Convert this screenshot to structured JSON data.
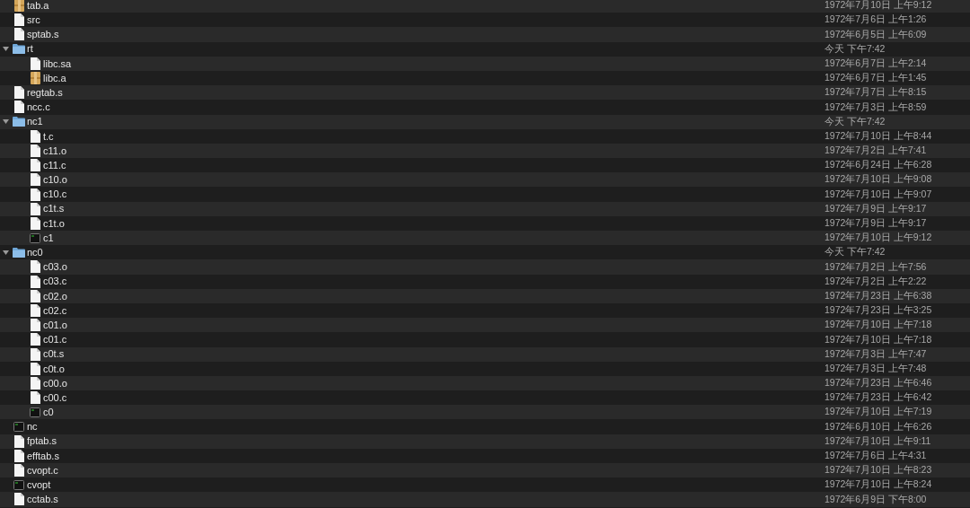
{
  "files": [
    {
      "name": "tab.a",
      "kind": "archive",
      "date": "1972年7月10日 上午9:12"
    },
    {
      "name": "src",
      "kind": "document",
      "date": "1972年7月6日 上午1:26"
    },
    {
      "name": "sptab.s",
      "kind": "document",
      "date": "1972年6月5日 上午6:09"
    },
    {
      "name": "rt",
      "kind": "folder",
      "expanded": true,
      "date": "今天 下午7:42",
      "children": [
        {
          "name": "libc.sa",
          "kind": "document",
          "date": "1972年6月7日 上午2:14"
        },
        {
          "name": "libc.a",
          "kind": "archive",
          "date": "1972年6月7日 上午1:45"
        }
      ]
    },
    {
      "name": "regtab.s",
      "kind": "document",
      "date": "1972年7月7日 上午8:15"
    },
    {
      "name": "ncc.c",
      "kind": "document",
      "date": "1972年7月3日 上午8:59"
    },
    {
      "name": "nc1",
      "kind": "folder",
      "expanded": true,
      "date": "今天 下午7:42",
      "children": [
        {
          "name": "t.c",
          "kind": "document",
          "date": "1972年7月10日 上午8:44"
        },
        {
          "name": "c11.o",
          "kind": "document",
          "date": "1972年7月2日 上午7:41"
        },
        {
          "name": "c11.c",
          "kind": "document",
          "date": "1972年6月24日 上午6:28"
        },
        {
          "name": "c10.o",
          "kind": "document",
          "date": "1972年7月10日 上午9:08"
        },
        {
          "name": "c10.c",
          "kind": "document",
          "date": "1972年7月10日 上午9:07"
        },
        {
          "name": "c1t.s",
          "kind": "document",
          "date": "1972年7月9日 上午9:17"
        },
        {
          "name": "c1t.o",
          "kind": "document",
          "date": "1972年7月9日 上午9:17"
        },
        {
          "name": "c1",
          "kind": "executable",
          "date": "1972年7月10日 上午9:12"
        }
      ]
    },
    {
      "name": "nc0",
      "kind": "folder",
      "expanded": true,
      "date": "今天 下午7:42",
      "children": [
        {
          "name": "c03.o",
          "kind": "document",
          "date": "1972年7月2日 上午7:56"
        },
        {
          "name": "c03.c",
          "kind": "document",
          "date": "1972年7月2日 上午2:22"
        },
        {
          "name": "c02.o",
          "kind": "document",
          "date": "1972年7月23日 上午6:38"
        },
        {
          "name": "c02.c",
          "kind": "document",
          "date": "1972年7月23日 上午3:25"
        },
        {
          "name": "c01.o",
          "kind": "document",
          "date": "1972年7月10日 上午7:18"
        },
        {
          "name": "c01.c",
          "kind": "document",
          "date": "1972年7月10日 上午7:18"
        },
        {
          "name": "c0t.s",
          "kind": "document",
          "date": "1972年7月3日 上午7:47"
        },
        {
          "name": "c0t.o",
          "kind": "document",
          "date": "1972年7月3日 上午7:48"
        },
        {
          "name": "c00.o",
          "kind": "document",
          "date": "1972年7月23日 上午6:46"
        },
        {
          "name": "c00.c",
          "kind": "document",
          "date": "1972年7月23日 上午6:42"
        },
        {
          "name": "c0",
          "kind": "executable",
          "date": "1972年7月10日 上午7:19"
        }
      ]
    },
    {
      "name": "nc",
      "kind": "executable",
      "date": "1972年6月10日 上午6:26"
    },
    {
      "name": "fptab.s",
      "kind": "document",
      "date": "1972年7月10日 上午9:11"
    },
    {
      "name": "efftab.s",
      "kind": "document",
      "date": "1972年7月6日 上午4:31"
    },
    {
      "name": "cvopt.c",
      "kind": "document",
      "date": "1972年7月10日 上午8:23"
    },
    {
      "name": "cvopt",
      "kind": "executable",
      "date": "1972年7月10日 上午8:24"
    },
    {
      "name": "cctab.s",
      "kind": "document",
      "date": "1972年6月9日 下午8:00"
    }
  ]
}
